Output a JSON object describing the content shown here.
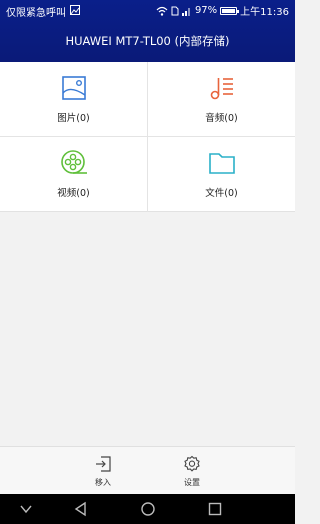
{
  "status_bar": {
    "carrier": "仅限紧急呼叫",
    "battery": "97%",
    "battery_level": 0.97,
    "time": "上午11:36"
  },
  "header": {
    "title": "HUAWEI MT7-TL00 (内部存储)"
  },
  "categories": [
    {
      "label": "图片(0)",
      "icon": "image-icon",
      "color": "#3a7bd5"
    },
    {
      "label": "音频(0)",
      "icon": "music-icon",
      "color": "#e8643c"
    },
    {
      "label": "视频(0)",
      "icon": "video-reel-icon",
      "color": "#5fbf3a"
    },
    {
      "label": "文件(0)",
      "icon": "folder-icon",
      "color": "#2ab0c8"
    }
  ],
  "bottom_actions": {
    "move_in_label": "移入",
    "settings_label": "设置"
  },
  "nav_bar": {
    "back": "back-icon",
    "home": "home-icon",
    "recents": "recents-icon"
  }
}
